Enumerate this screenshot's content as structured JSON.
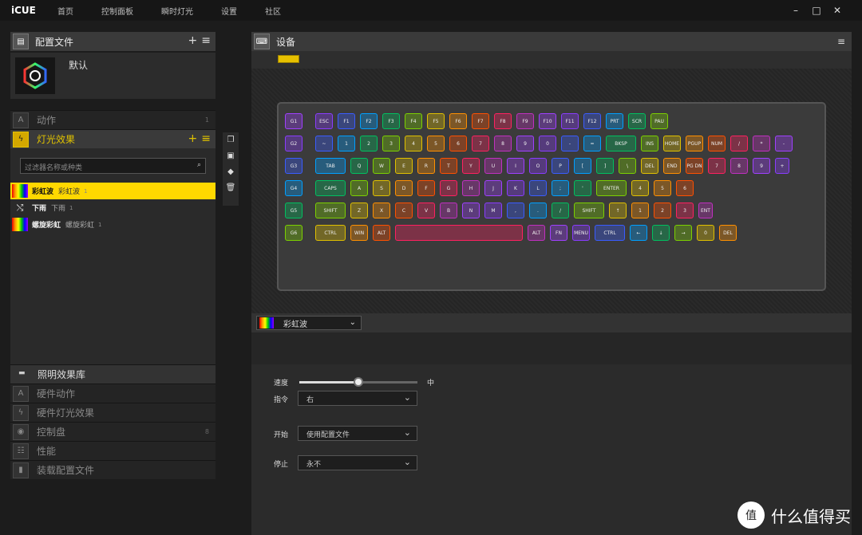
{
  "app": {
    "title": "iCUE"
  },
  "nav": [
    "首页",
    "控制面板",
    "瞬时灯光",
    "设置",
    "社区"
  ],
  "window_controls": {
    "minimize": "–",
    "maximize": "□",
    "close": "✕"
  },
  "profiles": {
    "title": "配置文件",
    "items": [
      {
        "name": "默认"
      }
    ]
  },
  "sections": [
    {
      "label": "动作",
      "count": "1"
    },
    {
      "label": "灯光效果",
      "count": ""
    }
  ],
  "filter": {
    "placeholder": "过滤器名称或种类"
  },
  "layers": [
    {
      "name": "彩虹波",
      "type": "彩虹波",
      "count": "1",
      "selected": true
    },
    {
      "name": "下雨",
      "type": "下雨",
      "count": "1",
      "selected": false
    },
    {
      "name": "螺旋彩虹",
      "type": "螺旋彩虹",
      "count": "1",
      "selected": false
    }
  ],
  "library": {
    "title": "照明效果库",
    "items": [
      {
        "label": "硬件动作",
        "count": ""
      },
      {
        "label": "硬件灯光效果",
        "count": ""
      },
      {
        "label": "控制盘",
        "count": "8"
      },
      {
        "label": "性能",
        "count": ""
      },
      {
        "label": "装载配置文件",
        "count": ""
      }
    ]
  },
  "devices": {
    "title": "设备"
  },
  "effect": {
    "name": "彩虹波"
  },
  "props": {
    "speed_label": "速度",
    "speed_value": "中",
    "speed_level": 0.5,
    "direction_label": "指令",
    "direction_value": "右",
    "start_label": "开始",
    "start_value": "使用配置文件",
    "stop_label": "停止",
    "stop_value": "永不"
  },
  "keyboard": {
    "rows": [
      [
        "G1",
        "ESC",
        "F1",
        "F2",
        "F3",
        "F4",
        "F5",
        "F6",
        "F7",
        "F8",
        "F9",
        "F10",
        "F11",
        "F12",
        "PRT",
        "SCR",
        "PAU"
      ],
      [
        "G2",
        "~",
        "1",
        "2",
        "3",
        "4",
        "5",
        "6",
        "7",
        "8",
        "9",
        "0",
        "-",
        "=",
        "BKSP",
        "INS",
        "HOME",
        "PGUP",
        "NUM",
        "/",
        "*",
        "-"
      ],
      [
        "G3",
        "TAB",
        "Q",
        "W",
        "E",
        "R",
        "T",
        "Y",
        "U",
        "I",
        "O",
        "P",
        "[",
        "]",
        "\\",
        "DEL",
        "END",
        "PG DN",
        "7",
        "8",
        "9",
        "+"
      ],
      [
        "G4",
        "CAPS",
        "A",
        "S",
        "D",
        "F",
        "G",
        "H",
        "J",
        "K",
        "L",
        ";",
        "'",
        "ENTER",
        "4",
        "5",
        "6"
      ],
      [
        "G5",
        "SHIFT",
        "Z",
        "X",
        "C",
        "V",
        "B",
        "N",
        "M",
        ",",
        ".",
        "/",
        "SHIFT",
        "↑",
        "1",
        "2",
        "3",
        "ENT"
      ],
      [
        "G6",
        "CTRL",
        "WIN",
        "ALT",
        "SPACE",
        "ALT",
        "FN",
        "MENU",
        "CTRL",
        "←",
        "↓",
        "→",
        "0",
        "DEL"
      ]
    ]
  },
  "watermark": {
    "symbol": "值",
    "text": "什么值得买"
  }
}
